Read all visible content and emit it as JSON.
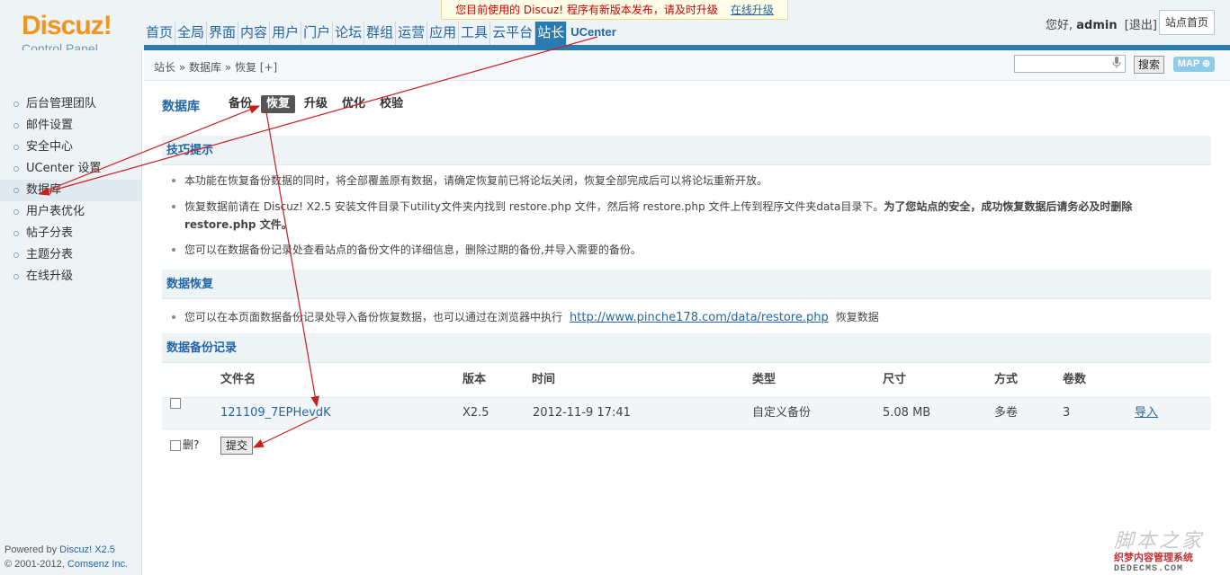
{
  "header": {
    "logo_brand": "Discuz!",
    "logo_sub": "Control Panel",
    "notice_text": "您目前使用的 Discuz! 程序有新版本发布，请及时升级",
    "notice_link": "在线升级",
    "nav": [
      "首页",
      "全局",
      "界面",
      "内容",
      "用户",
      "门户",
      "论坛",
      "群组",
      "运营",
      "应用",
      "工具",
      "云平台",
      "站长",
      "UCenter"
    ],
    "user_greeting": "您好,",
    "user_name": "admin",
    "logout": "[退出]",
    "site_home": "站点首页"
  },
  "breadcrumb": "站长 » 数据库 » 恢复 [+]",
  "search": {
    "button": "搜索",
    "map_button": "MAP",
    "map_icon": "plus-circle-icon"
  },
  "sidebar": {
    "items": [
      "后台管理团队",
      "邮件设置",
      "安全中心",
      "UCenter 设置",
      "数据库",
      "用户表优化",
      "帖子分表",
      "主题分表",
      "在线升级"
    ],
    "powered_by": "Powered by",
    "powered_link": "Discuz! X2.5",
    "copyright": "© 2001-2012,",
    "copyright_link": "Comsenz Inc."
  },
  "main": {
    "title": "数据库",
    "tabs": [
      "备份",
      "恢复",
      "升级",
      "优化",
      "校验"
    ],
    "tips_heading": "技巧提示",
    "tip1": "本功能在恢复备份数据的同时，将全部覆盖原有数据，请确定恢复前已将论坛关闭，恢复全部完成后可以将论坛重新开放。",
    "tip2_a": "恢复数据前请在 Discuz! X2.5 安装文件目录下utility文件夹内找到 restore.php 文件，然后将 restore.php 文件上传到程序文件夹data目录下。",
    "tip2_b": "为了您站点的安全，成功恢复数据后请务必及时删除 restore.php 文件。",
    "tip3": "您可以在数据备份记录处查看站点的备份文件的详细信息，删除过期的备份,并导入需要的备份。",
    "restore_heading": "数据恢复",
    "restore_tip_a": "您可以在本页面数据备份记录处导入备份恢复数据，也可以通过在浏览器中执行",
    "restore_tip_link": "http://www.pinche178.com/data/restore.php",
    "restore_tip_b": "恢复数据",
    "records_heading": "数据备份记录",
    "columns": [
      "文件名",
      "版本",
      "时间",
      "类型",
      "尺寸",
      "方式",
      "卷数"
    ],
    "row": {
      "file": "121109_7EPHevdK",
      "version": "X2.5",
      "time": "2012-11-9 17:41",
      "type": "自定义备份",
      "size": "5.08 MB",
      "mode": "多卷",
      "volumes": "3",
      "action": "导入"
    },
    "delete_label": "删?",
    "submit": "提交"
  },
  "watermark": {
    "line1": "脚本之家",
    "line2": "织梦内容管理系统",
    "line3": "DEDECMS.COM"
  },
  "colors": {
    "accent": "#2a7bb0",
    "link": "#2366a8",
    "logo": "#f0951d",
    "arrow": "#c81e1e"
  }
}
